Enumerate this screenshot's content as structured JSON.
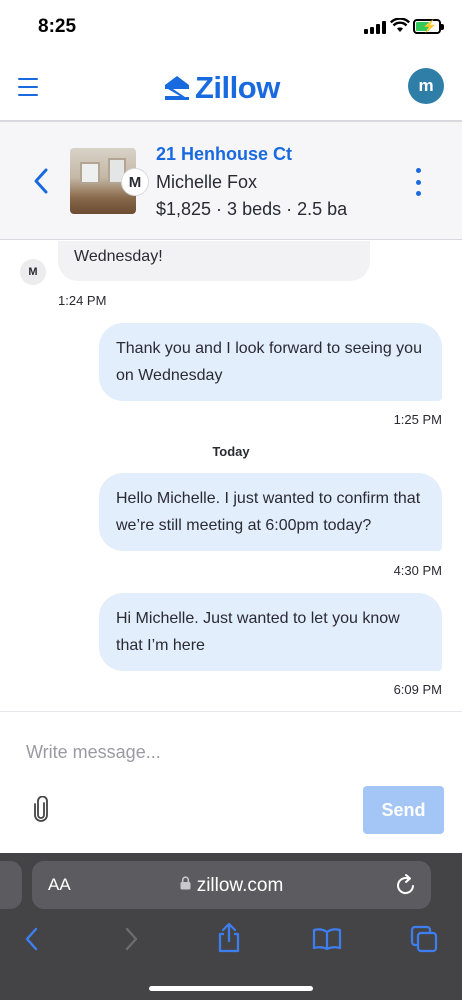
{
  "status_bar": {
    "time": "8:25"
  },
  "header": {
    "logo_text": "Zillow",
    "avatar_initial": "m"
  },
  "listing": {
    "address": "21 Henhouse Ct",
    "agent_name": "Michelle Fox",
    "agent_initial": "M",
    "facts": "$1,825 · 3 beds · 2.5 ba"
  },
  "conversation": {
    "incoming": {
      "text": "Wednesday!",
      "sender_initial": "M",
      "time": "1:24 PM"
    },
    "day_divider": "Today",
    "outgoing": [
      {
        "text": "Thank you and I look forward to seeing you on Wednesday",
        "time": "1:25 PM"
      },
      {
        "text": "Hello Michelle. I just wanted to confirm that we’re still meeting at 6:00pm today?",
        "time": "4:30 PM"
      },
      {
        "text": "Hi Michelle. Just wanted to let you know that I’m here",
        "time": "6:09 PM"
      }
    ]
  },
  "composer": {
    "placeholder": "Write message...",
    "send_label": "Send"
  },
  "browser": {
    "text_size_label": "AA",
    "url": "zillow.com"
  },
  "colors": {
    "brand_blue": "#1a6adf",
    "outgoing_bubble": "#e2eefb",
    "send_disabled": "#a4c6f7"
  }
}
